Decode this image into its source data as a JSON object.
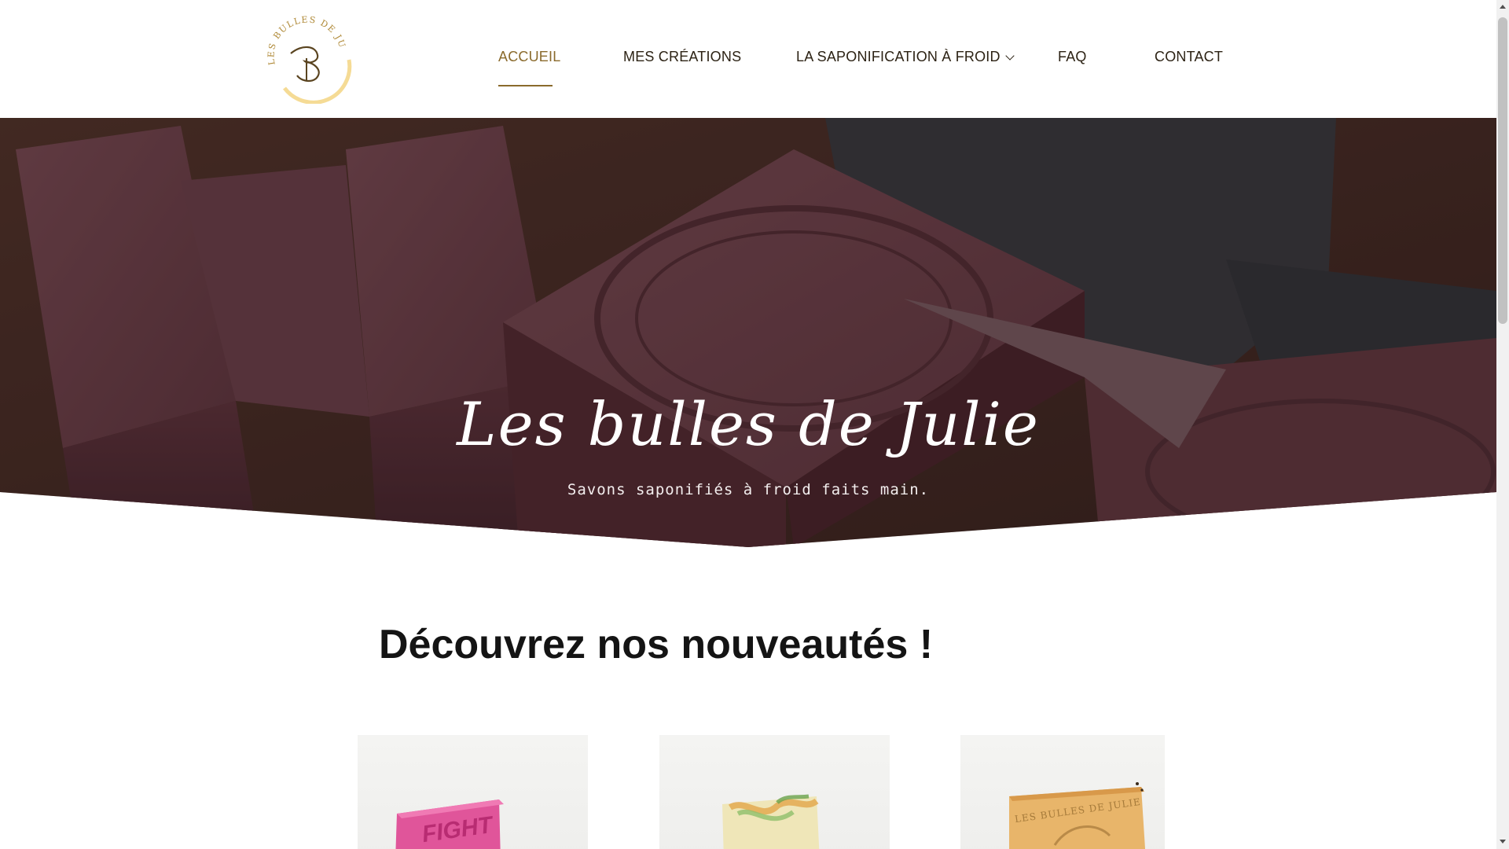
{
  "brand": {
    "logo_text": "LES BULLES DE JULIE",
    "logo_mark": "B",
    "accent_color": "#8a6a2c",
    "logo_color": "#c59a2e"
  },
  "nav": {
    "items": [
      {
        "label": "ACCUEIL",
        "active": true
      },
      {
        "label": "MES CRÉATIONS",
        "active": false
      },
      {
        "label": "LA SAPONIFICATION À FROID",
        "active": false,
        "has_dropdown": true,
        "dropdown_icon": "chevron-down-icon"
      },
      {
        "label": "FAQ",
        "active": false
      },
      {
        "label": "CONTACT",
        "active": false
      }
    ]
  },
  "hero": {
    "title": "Les bulles de Julie",
    "subtitle": "Savons saponifiés à froid faits main."
  },
  "section": {
    "title": "Découvrez nos nouveautés !"
  },
  "products": [
    {
      "soap_stamp": "FIGHT",
      "soap_color": "#e0559a"
    },
    {
      "soap_stamp": "",
      "soap_color": "#efe6b8"
    },
    {
      "soap_stamp": "LES BULLES DE JULIE",
      "soap_color": "#e8b56a"
    }
  ]
}
